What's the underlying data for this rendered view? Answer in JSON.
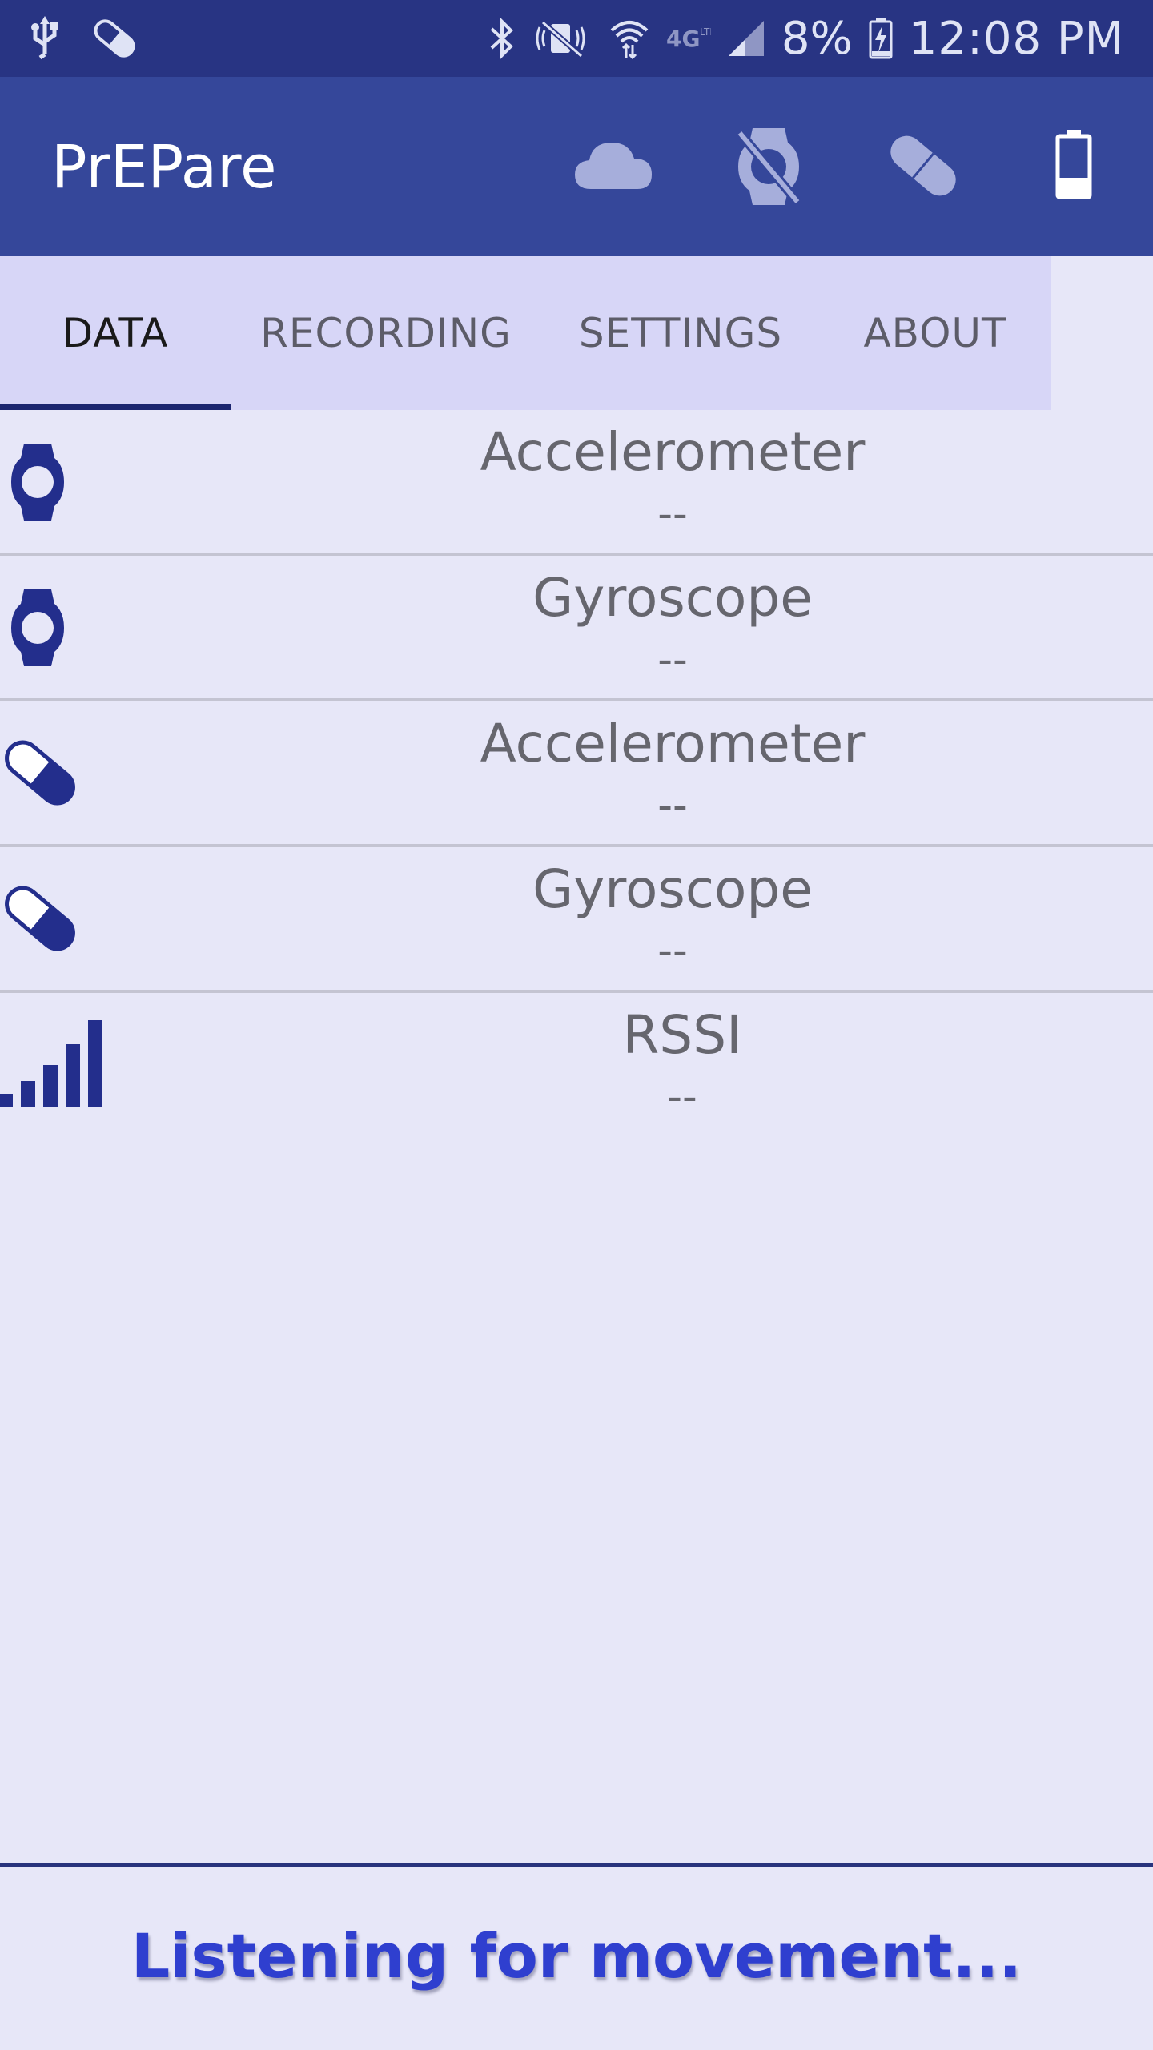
{
  "status_bar": {
    "battery_percent": "8%",
    "time": "12:08 PM",
    "icons": [
      "usb-icon",
      "pill-icon",
      "bluetooth-icon",
      "mute-icon",
      "wifi-icon",
      "4g-icon",
      "signal-icon",
      "battery-charging-icon"
    ]
  },
  "app_bar": {
    "title": "PrEPare",
    "icons": [
      "cloud-icon",
      "watch-disconnected-icon",
      "pill-icon",
      "battery-icon"
    ]
  },
  "tabs": [
    {
      "label": "DATA",
      "active": true
    },
    {
      "label": "RECORDING",
      "active": false
    },
    {
      "label": "SETTINGS",
      "active": false
    },
    {
      "label": "ABOUT",
      "active": false
    }
  ],
  "sensors": [
    {
      "icon": "watch-icon",
      "name": "Accelerometer",
      "value": "--"
    },
    {
      "icon": "watch-icon",
      "name": "Gyroscope",
      "value": "--"
    },
    {
      "icon": "pill-icon",
      "name": "Accelerometer",
      "value": "--"
    },
    {
      "icon": "pill-icon",
      "name": "Gyroscope",
      "value": "--"
    },
    {
      "icon": "signal-bars-icon",
      "name": "RSSI",
      "value": "--"
    }
  ],
  "footer": {
    "message": "Listening for movement..."
  },
  "colors": {
    "status_bar": "#283483",
    "app_bar": "#35479a",
    "tab_bar": "#d7d6f7",
    "background": "#e7e7f8",
    "accent": "#1c2670",
    "footer_text": "#2f3fcf"
  }
}
